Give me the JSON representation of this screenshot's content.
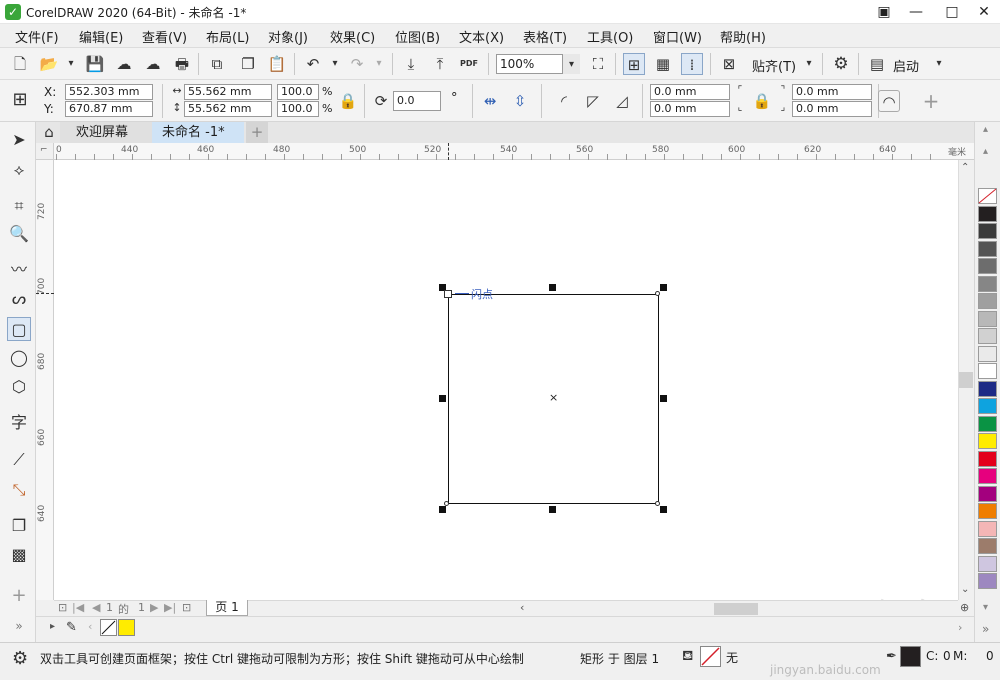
{
  "window": {
    "title": "CorelDRAW 2020 (64-Bit) - 未命名 -1*",
    "logo_glyph": "✓"
  },
  "menu": [
    {
      "label": "文件(F)"
    },
    {
      "label": "编辑(E)"
    },
    {
      "label": "查看(V)"
    },
    {
      "label": "布局(L)"
    },
    {
      "label": "对象(J)"
    },
    {
      "label": "效果(C)"
    },
    {
      "label": "位图(B)"
    },
    {
      "label": "文本(X)"
    },
    {
      "label": "表格(T)"
    },
    {
      "label": "工具(O)"
    },
    {
      "label": "窗口(W)"
    },
    {
      "label": "帮助(H)"
    }
  ],
  "toolbar": {
    "zoom": "100%",
    "pdf_label": "PDF",
    "snap_label": "贴齐(T)",
    "launch_label": "启动"
  },
  "property_bar": {
    "x_label": "X:",
    "y_label": "Y:",
    "x_value": "552.303 mm",
    "y_value": "670.87 mm",
    "width_value": "55.562 mm",
    "height_value": "55.562 mm",
    "scale_w": "100.0",
    "scale_h": "100.0",
    "percent": "%",
    "rotation": "0.0",
    "degree": "°",
    "corner_1": "0.0 mm",
    "corner_2": "0.0 mm",
    "corner_3": "0.0 mm",
    "corner_4": "0.0 mm"
  },
  "tabs": [
    {
      "label": "欢迎屏幕"
    },
    {
      "label": "未命名 -1*"
    }
  ],
  "ruler": {
    "h_labels": [
      "0",
      "440",
      "460",
      "480",
      "500",
      "520",
      "540",
      "560",
      "580",
      "600",
      "620",
      "640"
    ],
    "h_unit": "毫米",
    "v_labels": [
      "720",
      "700",
      "680",
      "660",
      "640"
    ]
  },
  "canvas": {
    "node_label": "闪点",
    "center_mark": "×"
  },
  "page_nav": {
    "current": "1",
    "of": "的",
    "total": "1",
    "page_tab": "页 1"
  },
  "status": {
    "hint": "双击工具可创建页面框架；按住 Ctrl 键拖动可限制为方形；按住 Shift 键拖动可从中心绘制",
    "object_info": "矩形 于 图层 1",
    "fill_none": "无",
    "cmyk_c": "C:",
    "cmyk_c_val": "0",
    "cmyk_m": "M:",
    "cmyk_m_val": "0"
  },
  "watermark": {
    "brand": "Bai du 经验",
    "url": "jingyan.baidu.com"
  },
  "palette": [
    "#ffffff",
    "#231f20",
    "#3b3b3b",
    "#545454",
    "#6d6d6d",
    "#868686",
    "#9f9f9f",
    "#b8b8b8",
    "#d1d1d1",
    "#eaeaea",
    "#ffffff",
    "#1d2a85",
    "#0ea3df",
    "#0a9344",
    "#ffec00",
    "#e3001b",
    "#e6007e",
    "#a3007e",
    "#ef7d00",
    "#f4b6b6",
    "#9c7c6b",
    "#cfc6e0",
    "#9d88c0"
  ],
  "colors": {
    "accent_green": "#3aa63a",
    "fill_swatch": "#ffec00",
    "outline_swatch": "#231f20"
  }
}
